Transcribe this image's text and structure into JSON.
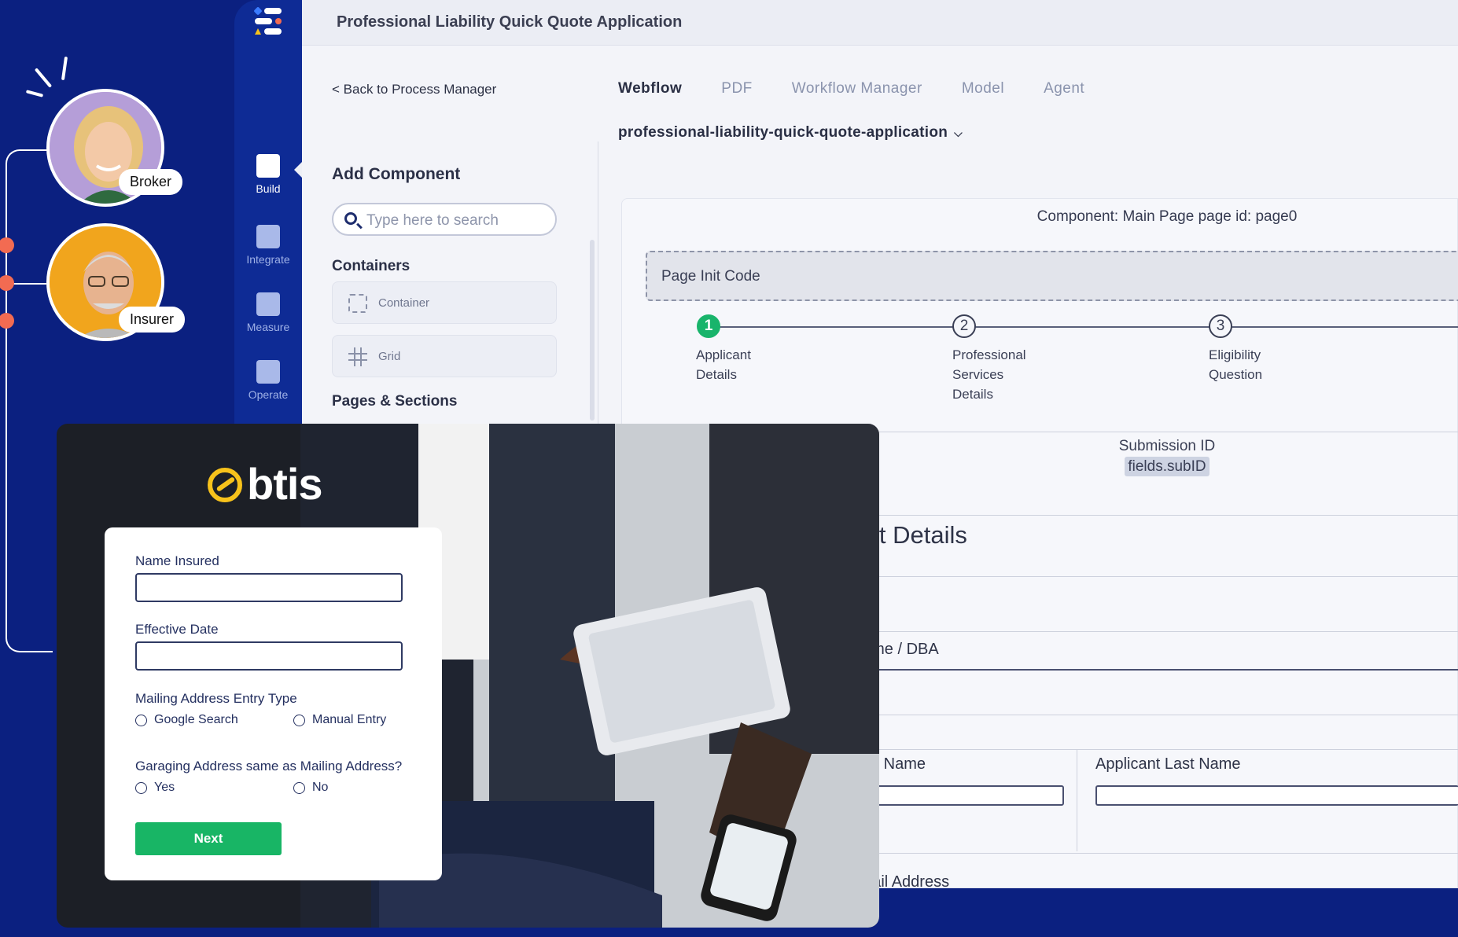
{
  "personas": [
    {
      "label": "Broker"
    },
    {
      "label": "Insurer"
    }
  ],
  "rail": {
    "items": [
      {
        "label": "Build",
        "icon": "monitor-icon"
      },
      {
        "label": "Integrate",
        "icon": "users-icon"
      },
      {
        "label": "Measure",
        "icon": "bar-chart-icon"
      },
      {
        "label": "Operate",
        "icon": "grid-icon"
      }
    ]
  },
  "app": {
    "title": "Professional Liability Quick Quote Application",
    "back_link": "< Back to Process Manager",
    "tabs": [
      "Webflow",
      "PDF",
      "Workflow Manager",
      "Model",
      "Agent"
    ],
    "active_tab": "Webflow",
    "slug": "professional-liability-quick-quote-application"
  },
  "sidebar": {
    "heading": "Add Component",
    "search_placeholder": "Type here to search",
    "containers_heading": "Containers",
    "components": [
      {
        "label": "Container"
      },
      {
        "label": "Grid"
      }
    ],
    "pages_heading": "Pages & Sections"
  },
  "canvas": {
    "component_label": "Component: Main Page page id: page0",
    "init_code": "Page Init Code",
    "steps": [
      {
        "number": "1",
        "lines": [
          "Applicant",
          "Details"
        ]
      },
      {
        "number": "2",
        "lines": [
          "Professional",
          "Services",
          "Details"
        ]
      },
      {
        "number": "3",
        "lines": [
          "Eligibility",
          "Question"
        ]
      }
    ],
    "submission_label": "Submission ID",
    "submission_value": "fields.subID",
    "section_title": "icant Details",
    "field_business": "ss Name / DBA",
    "field_first": "nt First Name",
    "field_last": "Applicant Last Name",
    "field_email": "nt Email Address"
  },
  "overlay": {
    "brand": "btis",
    "form": {
      "name_label": "Name Insured",
      "date_label": "Effective Date",
      "mailing_label": "Mailing Address Entry Type",
      "mailing_options": [
        "Google Search",
        "Manual Entry"
      ],
      "garaging_label": "Garaging Address same as Mailing Address?",
      "garaging_options": [
        "Yes",
        "No"
      ],
      "next_label": "Next"
    }
  },
  "colors": {
    "background": "#0b2080",
    "accent_green": "#18b565",
    "brand_yellow": "#f7c21b",
    "dot": "#f26b52"
  }
}
